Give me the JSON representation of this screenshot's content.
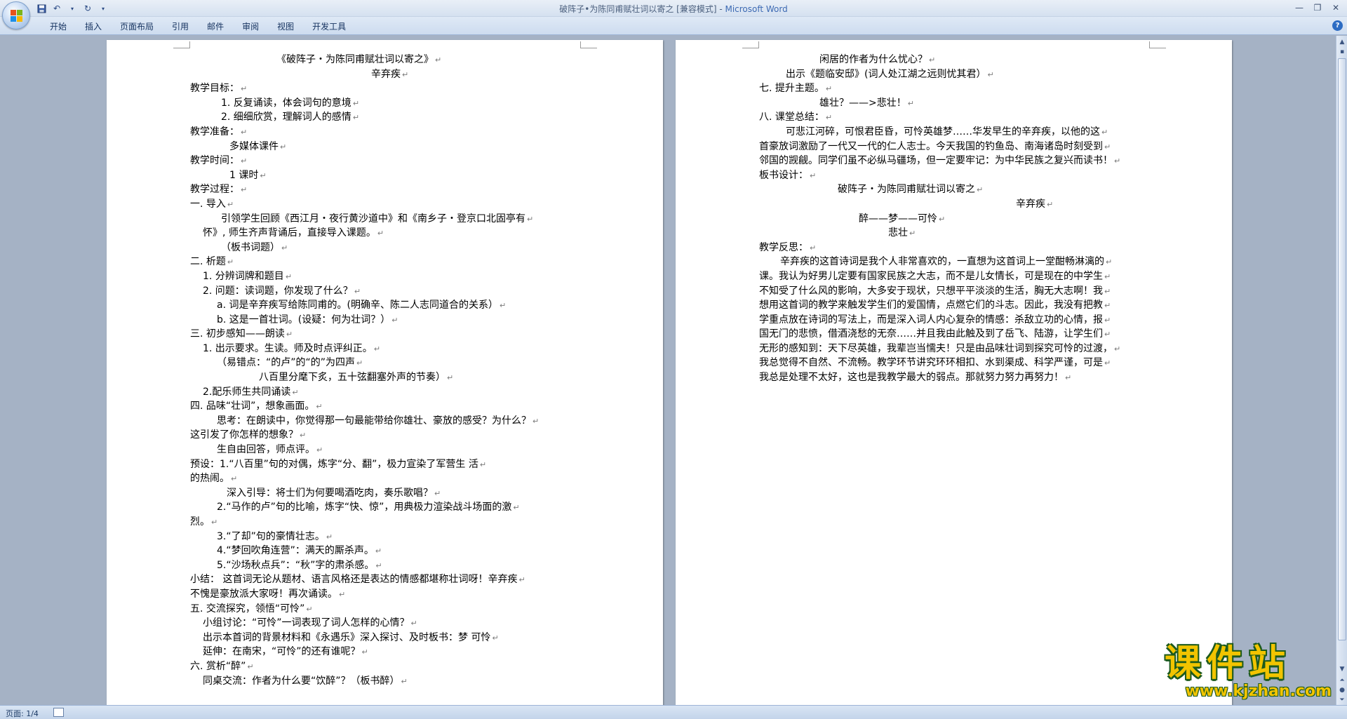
{
  "window": {
    "title": "破阵子•为陈同甫赋壮词以寄之 [兼容模式] - ",
    "app_name": "Microsoft Word"
  },
  "qat": {
    "save_icon": "save-icon",
    "undo_icon": "undo-icon",
    "redo_icon": "redo-icon",
    "customize_icon": "customize-icon"
  },
  "ribbon": {
    "tabs": [
      "开始",
      "插入",
      "页面布局",
      "引用",
      "邮件",
      "审阅",
      "视图",
      "开发工具"
    ]
  },
  "page1": {
    "lines": [
      {
        "text": "《破阵子・为陈同甫赋壮词以寄之》",
        "indent": 123
      },
      {
        "text": "辛弃疾",
        "indent": 258
      },
      {
        "text": "教学目标：",
        "indent": 0
      },
      {
        "text": "1.  反复诵读，体会词句的意境",
        "indent": 44
      },
      {
        "text": "2.  细细欣赏，理解词人的感情",
        "indent": 44
      },
      {
        "text": "教学准备：",
        "indent": 0
      },
      {
        "text": "多媒体课件",
        "indent": 56
      },
      {
        "text": "教学时间：",
        "indent": 0
      },
      {
        "text": "1 课时",
        "indent": 56
      },
      {
        "text": "教学过程：",
        "indent": 0
      },
      {
        "text": "一. 导入",
        "indent": 0
      },
      {
        "text": "引领学生回顾《西江月・夜行黄沙道中》和《南乡子・登京口北固亭有",
        "indent": 44
      },
      {
        "text": "怀》, 师生齐声背诵后，直接导入课题。",
        "indent": 18
      },
      {
        "text": "（板书词题）",
        "indent": 44
      },
      {
        "text": "二. 析题",
        "indent": 0
      },
      {
        "text": "1.  分辨词牌和题目",
        "indent": 18
      },
      {
        "text": "2.  问题：读词题，你发现了什么？",
        "indent": 18
      },
      {
        "text": "a.  词是辛弃疾写给陈同甫的。(明确辛、陈二人志同道合的关系）",
        "indent": 38
      },
      {
        "text": "b.  这是一首壮词。(设疑：何为壮词？）",
        "indent": 38
      },
      {
        "text": "三. 初步感知——朗读",
        "indent": 0
      },
      {
        "text": "1.  出示要求。生读。师及时点评纠正。",
        "indent": 18
      },
      {
        "text": "（易错点：“的卢”的“的”为四声",
        "indent": 38
      },
      {
        "text": "八百里分麾下炙，五十弦翻塞外声的节奏）",
        "indent": 98
      },
      {
        "text": "2.配乐师生共同诵读",
        "indent": 18
      },
      {
        "text": "四. 品味“壮词”，想象画面。",
        "indent": 0
      },
      {
        "text": "思考：在朗读中，你觉得那一句最能带给你雄壮、豪放的感受？为什么？",
        "indent": 38
      },
      {
        "text": "这引发了你怎样的想象？",
        "indent": 0
      },
      {
        "text": "生自由回答，师点评。",
        "indent": 38
      },
      {
        "text": "预设：1.“八百里”句的对偶，炼字“分、翻”，极力宣染了军营生                    活",
        "indent": 0
      },
      {
        "text": "的热闹。",
        "indent": 0
      },
      {
        "text": "深入引导：将士们为何要喝酒吃肉，奏乐歌唱？",
        "indent": 52
      },
      {
        "text": "2.“马作的卢”句的比喻，炼字“快、惊”，用典极力渲染战斗场面的激",
        "indent": 38
      },
      {
        "text": "烈。",
        "indent": 0
      },
      {
        "text": "3.“了却”句的豪情壮志。",
        "indent": 38
      },
      {
        "text": "4.“梦回吹角连营”：满天的厮杀声。",
        "indent": 38
      },
      {
        "text": "5.“沙场秋点兵”：“秋”字的肃杀感。",
        "indent": 38
      },
      {
        "text": "小结：      这首词无论从题材、语言风格还是表达的情感都堪称壮词呀！辛弃疾",
        "indent": 0
      },
      {
        "text": "不愧是豪放派大家呀！再次诵读。",
        "indent": 0
      },
      {
        "text": "五. 交流探究，领悟“可怜”",
        "indent": 0
      },
      {
        "text": "小组讨论：“可怜”一词表现了词人怎样的心情？",
        "indent": 18
      },
      {
        "text": "出示本首词的背景材料和《永遇乐》深入探讨、及时板书：梦    可怜",
        "indent": 18
      },
      {
        "text": "延伸：在南宋，“可怜”的还有谁呢？",
        "indent": 18
      },
      {
        "text": "六. 赏析“醉”",
        "indent": 0
      },
      {
        "text": "同桌交流：作者为什么要“饮醉”？（板书醉）",
        "indent": 18
      }
    ]
  },
  "page2": {
    "lines": [
      {
        "text": "闲居的作者为什么忧心？",
        "indent": 86
      },
      {
        "text": "出示《题临安邸》(词人处江湖之远则忧其君）",
        "indent": 38
      },
      {
        "text": "七. 提升主题。",
        "indent": 0
      },
      {
        "text": "雄壮？——>悲壮！",
        "indent": 86
      },
      {
        "text": "八. 课堂总结：",
        "indent": 0
      },
      {
        "text": "可悲江河碎，可恨君臣昏，可怜英雄梦……华发早生的辛弃疾，以他的这",
        "indent": 38
      },
      {
        "text": "首豪放词激励了一代又一代的仁人志士。今天我国的钓鱼岛、南海诸岛时刻受到",
        "indent": 0
      },
      {
        "text": "邻国的觊觎。同学们虽不必纵马疆场，但一定要牢记：为中华民族之复兴而读书！",
        "indent": 0
      },
      {
        "text": "板书设计：",
        "indent": 0
      },
      {
        "text": "破阵子・为陈同甫赋壮词以寄之",
        "indent": 112
      },
      {
        "text": "辛弃疾",
        "indent": 366
      },
      {
        "text": "醉——梦——可怜",
        "indent": 142
      },
      {
        "text": "悲壮",
        "indent": 184
      },
      {
        "text": "教学反思：",
        "indent": 0
      },
      {
        "text": "辛弃疾的这首诗词是我个人非常喜欢的，一直想为这首词上一堂酣畅淋漓的",
        "indent": 30
      },
      {
        "text": "课。我认为好男儿定要有国家民族之大志，而不是儿女情长，可是现在的中学生",
        "indent": 0
      },
      {
        "text": "不知受了什么风的影响，大多安于现状，只想平平淡淡的生活，胸无大志啊！我",
        "indent": 0
      },
      {
        "text": "想用这首词的教学来触发学生们的爱国情，点燃它们的斗志。因此，我没有把教",
        "indent": 0
      },
      {
        "text": "学重点放在诗词的写法上，而是深入词人内心复杂的情感：杀敌立功的心情，报",
        "indent": 0
      },
      {
        "text": "国无门的悲愤，借酒浇愁的无奈……并且我由此触及到了岳飞、陆游，让学生们",
        "indent": 0
      },
      {
        "text": "无形的感知到：天下尽英雄，我辈岂当懦夫！只是由品味壮词到探究可怜的过渡，",
        "indent": 0
      },
      {
        "text": "我总觉得不自然、不流畅。教学环节讲究环环相扣、水到渠成、科学严谨，可是",
        "indent": 0
      },
      {
        "text": "我总是处理不太好，这也是我教学最大的弱点。那就努力努力再努力！",
        "indent": 0
      }
    ]
  },
  "paragraph_mark": "↵",
  "statusbar": {
    "page_info": "页面: 1/4"
  },
  "watermark": {
    "title": "课件站",
    "url": "www.kjzhan.com"
  }
}
